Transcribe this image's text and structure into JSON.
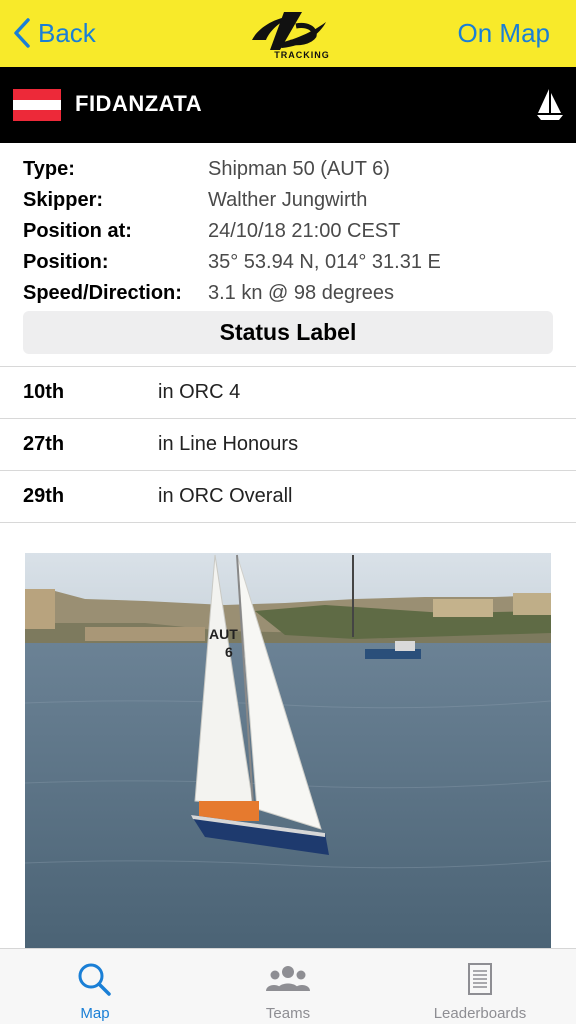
{
  "nav": {
    "back_label": "Back",
    "on_map_label": "On Map",
    "logo_text": "TRACKING",
    "accent_color": "#f8ea2a",
    "link_color": "#1a7fd6"
  },
  "boat": {
    "name": "FIDANZATA",
    "flag": "Austria",
    "flag_colors": [
      "#ed2939",
      "#ffffff",
      "#ed2939"
    ]
  },
  "info": [
    {
      "label": "Type:",
      "value": "Shipman 50 (AUT 6)"
    },
    {
      "label": "Skipper:",
      "value": "Walther Jungwirth"
    },
    {
      "label": "Position at:",
      "value": "24/10/18 21:00 CEST"
    },
    {
      "label": "Position:",
      "value": "35° 53.94 N, 014° 31.31 E"
    },
    {
      "label": "Speed/Direction:",
      "value": "3.1 kn @ 98 degrees"
    }
  ],
  "status_label": "Status Label",
  "rankings": [
    {
      "position": "10th",
      "description": "in ORC 4"
    },
    {
      "position": "27th",
      "description": "in Line Honours"
    },
    {
      "position": "29th",
      "description": "in ORC Overall"
    }
  ],
  "photo": {
    "sail_text_1": "AUT",
    "sail_text_2": "6"
  },
  "tabs": [
    {
      "label": "Map",
      "icon": "search-icon",
      "active": true
    },
    {
      "label": "Teams",
      "icon": "people-icon",
      "active": false
    },
    {
      "label": "Leaderboards",
      "icon": "document-icon",
      "active": false
    }
  ]
}
